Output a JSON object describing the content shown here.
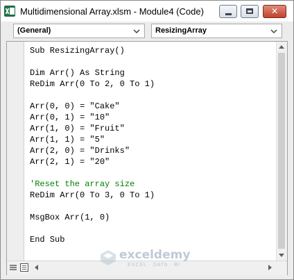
{
  "window": {
    "title": "Multidimensional Array.xlsm - Module4 (Code)",
    "close_glyph": "✕"
  },
  "object_dropdown": {
    "value": "(General)"
  },
  "procedure_dropdown": {
    "value": "ResizingArray"
  },
  "code_lines": [
    "Sub ResizingArray()",
    "",
    "Dim Arr() As String",
    "ReDim Arr(0 To 2, 0 To 1)",
    "",
    "Arr(0, 0) = \"Cake\"",
    "Arr(0, 1) = \"10\"",
    "Arr(1, 0) = \"Fruit\"",
    "Arr(1, 1) = \"5\"",
    "Arr(2, 0) = \"Drinks\"",
    "Arr(2, 1) = \"20\"",
    "",
    "'Reset the array size",
    "ReDim Arr(0 To 3, 0 To 1)",
    "",
    "MsgBox Arr(1, 0)",
    "",
    "End Sub"
  ],
  "colors": {
    "comment": "#008000",
    "code": "#000000",
    "close_button": "#c0432e"
  },
  "watermark": {
    "name": "exceldemy",
    "tagline": "EXCEL · DATA · BI"
  }
}
